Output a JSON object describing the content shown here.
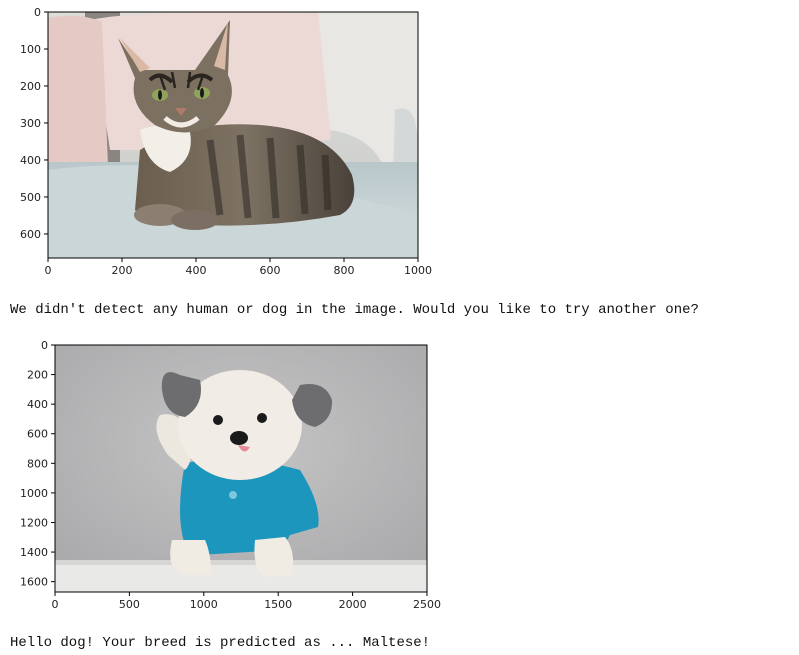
{
  "outputs": [
    {
      "plot": {
        "image_name": "cat-photo",
        "x_range": [
          0,
          1000
        ],
        "y_range": [
          0,
          665
        ],
        "x_ticks": [
          "0",
          "200",
          "400",
          "600",
          "800",
          "1000"
        ],
        "y_ticks": [
          "0",
          "100",
          "200",
          "300",
          "400",
          "500",
          "600"
        ],
        "y_tick_values": [
          0,
          100,
          200,
          300,
          400,
          500,
          600
        ]
      },
      "message": "We didn't detect any human or dog in the image. Would you like to try another one?"
    },
    {
      "plot": {
        "image_name": "dog-photo",
        "x_range": [
          0,
          2500
        ],
        "y_range": [
          0,
          1670
        ],
        "x_ticks": [
          "0",
          "500",
          "1000",
          "1500",
          "2000",
          "2500"
        ],
        "y_ticks": [
          "0",
          "200",
          "400",
          "600",
          "800",
          "1000",
          "1200",
          "1400",
          "1600"
        ],
        "y_tick_values": [
          0,
          200,
          400,
          600,
          800,
          1000,
          1200,
          1400,
          1600
        ]
      },
      "message": "Hello dog! Your breed is predicted as ... Maltese!"
    }
  ]
}
